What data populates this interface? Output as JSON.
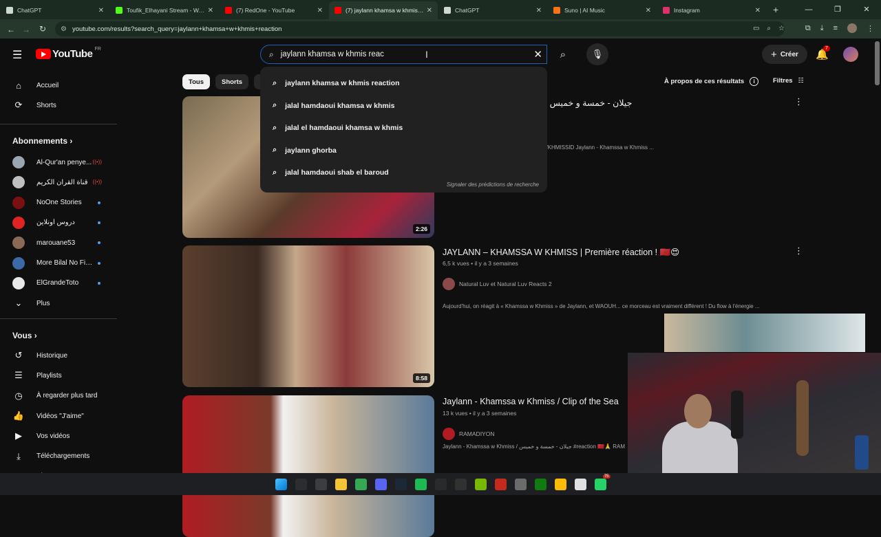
{
  "browser": {
    "tabs": [
      {
        "title": "ChatGPT",
        "color": "#cfd8d2",
        "active": false
      },
      {
        "title": "Toufik_Elhayani Stream - Watch",
        "color": "#53fc18",
        "active": false
      },
      {
        "title": "(7) RedOne - YouTube",
        "color": "#ff0000",
        "active": false
      },
      {
        "title": "(7) jaylann khamsa w khmis rea",
        "color": "#ff0000",
        "active": true
      },
      {
        "title": "ChatGPT",
        "color": "#cfd8d2",
        "active": false
      },
      {
        "title": "Suno | AI Music",
        "color": "#f97316",
        "active": false
      },
      {
        "title": "Instagram",
        "color": "#e1306c",
        "active": false
      }
    ],
    "tab_close": "✕",
    "new_tab": "+",
    "window_controls": [
      "—",
      "❐",
      "✕"
    ],
    "url": "youtube.com/results?search_query=jaylann+khamsa+w+khmis+reaction"
  },
  "header": {
    "logo_text": "YouTube",
    "country_code": "FR",
    "search_value": "jaylann khamsa w khmis reac",
    "create_label": "Créer",
    "notifications_count": "7"
  },
  "suggestions": {
    "items": [
      "jaylann khamsa w khmis reaction",
      "jalal hamdaoui khamsa w khmis",
      "jalal el hamdaoui khamsa w khmis",
      "jaylann ghorba",
      "jalal hamdaoui shab el baroud"
    ],
    "report_label": "Signaler des prédictions de recherche"
  },
  "sidebar": {
    "main": [
      {
        "label": "Accueil",
        "icon": "home-icon",
        "glyph": "⌂"
      },
      {
        "label": "Shorts",
        "icon": "shorts-icon",
        "glyph": "⟳"
      }
    ],
    "subscriptions_title": "Abonnements",
    "subscriptions": [
      {
        "name": "Al-Qur'an penye...",
        "color": "#9aa7b0",
        "status": "live"
      },
      {
        "name": "قناة القرآن الكريم",
        "color": "#bfbfbf",
        "status": "live"
      },
      {
        "name": "NoOne Stories",
        "color": "#7a1010",
        "status": "new"
      },
      {
        "name": "دروس أونلاين",
        "color": "#e02424",
        "status": "new"
      },
      {
        "name": "marouane53",
        "color": "#8a6a55",
        "status": "new"
      },
      {
        "name": "More Bilal No Filt...",
        "color": "#3c6aa8",
        "status": "new"
      },
      {
        "name": "ElGrandeToto",
        "color": "#e8e8e8",
        "status": "new"
      }
    ],
    "more_label": "Plus",
    "you_title": "Vous",
    "you_items": [
      {
        "label": "Historique",
        "glyph": "↺"
      },
      {
        "label": "Playlists",
        "glyph": "☰"
      },
      {
        "label": "À regarder plus tard",
        "glyph": "◷"
      },
      {
        "label": "Vidéos \"J'aime\"",
        "glyph": "👍"
      },
      {
        "label": "Vos vidéos",
        "glyph": "▶"
      },
      {
        "label": "Téléchargements",
        "glyph": "⤓"
      },
      {
        "label": "Plus",
        "glyph": "⌄"
      }
    ]
  },
  "filters": {
    "chips": [
      "Tous",
      "Shorts",
      "V"
    ],
    "about_label": "À propos de ces résultats",
    "filters_label": "Filtres"
  },
  "results": [
    {
      "title": "miss [Official Music Video] | جيلان - خمسة و خميس",
      "meta": "",
      "channel": "",
      "desc": "atforms : https://jaylann.lnk.to/KHAMSSAWKHMISSID Jaylann - Khamssa w Khmiss ...",
      "duration": "2:26",
      "thumb": "linear-gradient(135deg,#7a6b52 0%,#b49b7a 30%,#5a3b2a 55%,#a8233a 80%,#2f3a5c 100%)"
    },
    {
      "title": "JAYLANN – KHAMSSA W KHMISS | Première réaction ! 🇲🇦😍",
      "meta": "6,5 k vues • il y a 3 semaines",
      "channel": "Natural Luv et Natural Luv Reacts 2",
      "desc": "Aujourd'hui, on réagit à « Khamssa w Khmiss » de Jaylann, et WAOUH... ce morceau est vraiment différent ! Du flow à l'énergie ...",
      "duration": "8:58",
      "thumb": "linear-gradient(90deg,#5b3f2e 0%,#3a2a22 30%,#c4a88a 45%,#8c3a3a 65%,#d8c7a8 100%)"
    },
    {
      "title": "Jaylann - Khamssa w Khmiss / Clip of the Sea",
      "meta": "13 k vues • il y a 3 semaines",
      "channel": "RAMADIYON",
      "desc": "Jaylann - Khamssa w Khmiss / جيلان - خمسة و خميس #reaction 🇲🇦🙏 RAM",
      "duration": "",
      "thumb": "linear-gradient(90deg,#b01c22 0%,#7a3a2a 35%,#f2f2f2 40%,#c9b59a 60%,#5a7a9a 100%)"
    }
  ],
  "taskbar_apps": [
    {
      "name": "windows-start",
      "color": "#0078d4"
    },
    {
      "name": "search",
      "color": "#2b2d31"
    },
    {
      "name": "task-view",
      "color": "#3a3d42"
    },
    {
      "name": "file-explorer",
      "color": "#f2c438"
    },
    {
      "name": "chrome",
      "color": "#34a853"
    },
    {
      "name": "discord",
      "color": "#5865f2"
    },
    {
      "name": "steam",
      "color": "#1b2838"
    },
    {
      "name": "spotify",
      "color": "#1db954"
    },
    {
      "name": "davinci",
      "color": "#2a2a2a"
    },
    {
      "name": "epic-games",
      "color": "#313131"
    },
    {
      "name": "nvidia",
      "color": "#76b900"
    },
    {
      "name": "obs",
      "color": "#c42b1c"
    },
    {
      "name": "photo",
      "color": "#6b6b6b"
    },
    {
      "name": "xbox",
      "color": "#107c10"
    },
    {
      "name": "chrome-active",
      "color": "#fbbc05"
    },
    {
      "name": "app-badge",
      "color": "#e0e0e0"
    },
    {
      "name": "whatsapp",
      "color": "#25d366"
    }
  ],
  "taskbar_badge": "75"
}
